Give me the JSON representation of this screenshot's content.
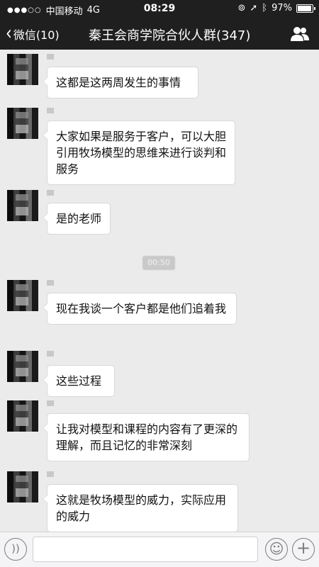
{
  "status_bar": {
    "carrier": "中国移动",
    "network": "4G",
    "time": "08:29",
    "battery": "97%",
    "battery_level": 0.97
  },
  "header": {
    "back_label": "微信(10)",
    "title": "秦王会商学院合伙人群(347)"
  },
  "messages": [
    {
      "text": "这都是这两周发生的事情"
    },
    {
      "text": "大家如果是服务于客户，可以大胆引用牧场模型的思维来进行谈判和服务"
    },
    {
      "text": "是的老师"
    },
    {
      "text": "现在我谈一个客户都是他们追着我"
    },
    {
      "text": "这些过程"
    },
    {
      "text": "让我对模型和课程的内容有了更深的理解，而且记忆的非常深刻"
    },
    {
      "text": "这就是牧场模型的威力，实际应用的威力"
    }
  ],
  "timestamp": "00:50",
  "input_bar": {
    "placeholder": ""
  },
  "colors": {
    "nav_background": "#1f1f1f",
    "chat_background": "#ebebeb",
    "bubble_background": "#ffffff"
  }
}
